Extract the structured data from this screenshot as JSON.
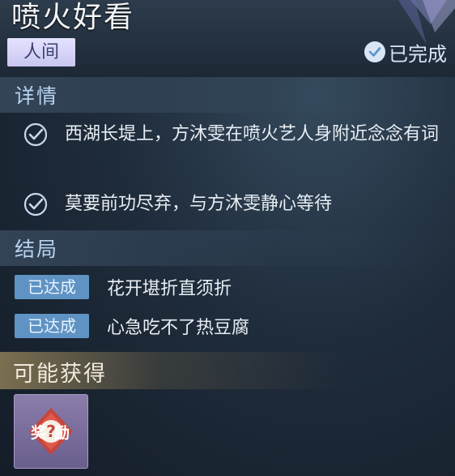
{
  "quest": {
    "title": "喷火好看",
    "category": "人间",
    "status": "已完成"
  },
  "details": {
    "header": "详情",
    "items": [
      "西湖长堤上，方沐雯在喷火艺人身附近念念有词",
      "莫要前功尽弃，与方沐雯静心等待"
    ]
  },
  "endings": {
    "header": "结局",
    "badge": "已达成",
    "items": [
      "花开堪折直须折",
      "心急吃不了热豆腐"
    ]
  },
  "rewards": {
    "header": "可能获得",
    "item_icon": "mystery-reward-icon",
    "item_label": "奖励"
  },
  "colors": {
    "accent": "#5f93c4",
    "tag": "#d6d3f7",
    "reward_frame": "#7a6e9c"
  }
}
